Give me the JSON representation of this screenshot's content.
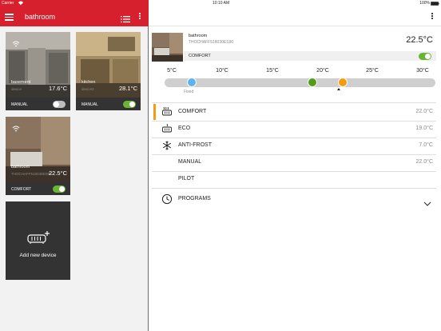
{
  "status_bar": {
    "carrier": "Carrier",
    "time": "10:10 AM",
    "battery": "100%"
  },
  "nav": {
    "title": "bathroom"
  },
  "devices": [
    {
      "name": "basement",
      "sub": "device",
      "temp": "17.6°C",
      "mode": "MANUAL",
      "toggle_on": false
    },
    {
      "name": "kitchen",
      "sub": "device2",
      "temp": "28.1°C",
      "mode": "MANUAL",
      "toggle_on": true
    },
    {
      "name": "bathroom",
      "sub": "THOCHAFF518030ES90",
      "temp": "22.5°C",
      "mode": "COMFORT",
      "toggle_on": true
    }
  ],
  "add_device": {
    "label": "Add new device"
  },
  "detail": {
    "name": "bathroom",
    "id": "THOCHAFF518030ES90",
    "temp": "22.5°C",
    "mode": "COMFORT",
    "mode_toggle_on": true,
    "scale": [
      "5°C",
      "10°C",
      "15°C",
      "20°C",
      "25°C",
      "30°C"
    ],
    "fixed_label": "Fixed",
    "setpoints": {
      "fixed": 7,
      "eco": 19,
      "comfort": 22
    },
    "colors": {
      "fixed": "#5bb4f0",
      "eco": "#4f9d1a",
      "comfort": "#f39c12",
      "accent": "#d6202e"
    }
  },
  "modes": [
    {
      "label": "COMFORT",
      "value": "22.0°C",
      "icon": "comfort-heater-icon",
      "active": true
    },
    {
      "label": "ECO",
      "value": "19.0°C",
      "icon": "eco-heater-icon"
    },
    {
      "label": "ANTI-FROST",
      "value": "7.0°C",
      "icon": "snowflake-icon"
    },
    {
      "label": "MANUAL",
      "value": "22.0°C",
      "icon": ""
    },
    {
      "label": "PILOT",
      "value": "",
      "icon": ""
    }
  ],
  "programs": {
    "label": "PROGRAMS",
    "icon": "clock-icon"
  }
}
